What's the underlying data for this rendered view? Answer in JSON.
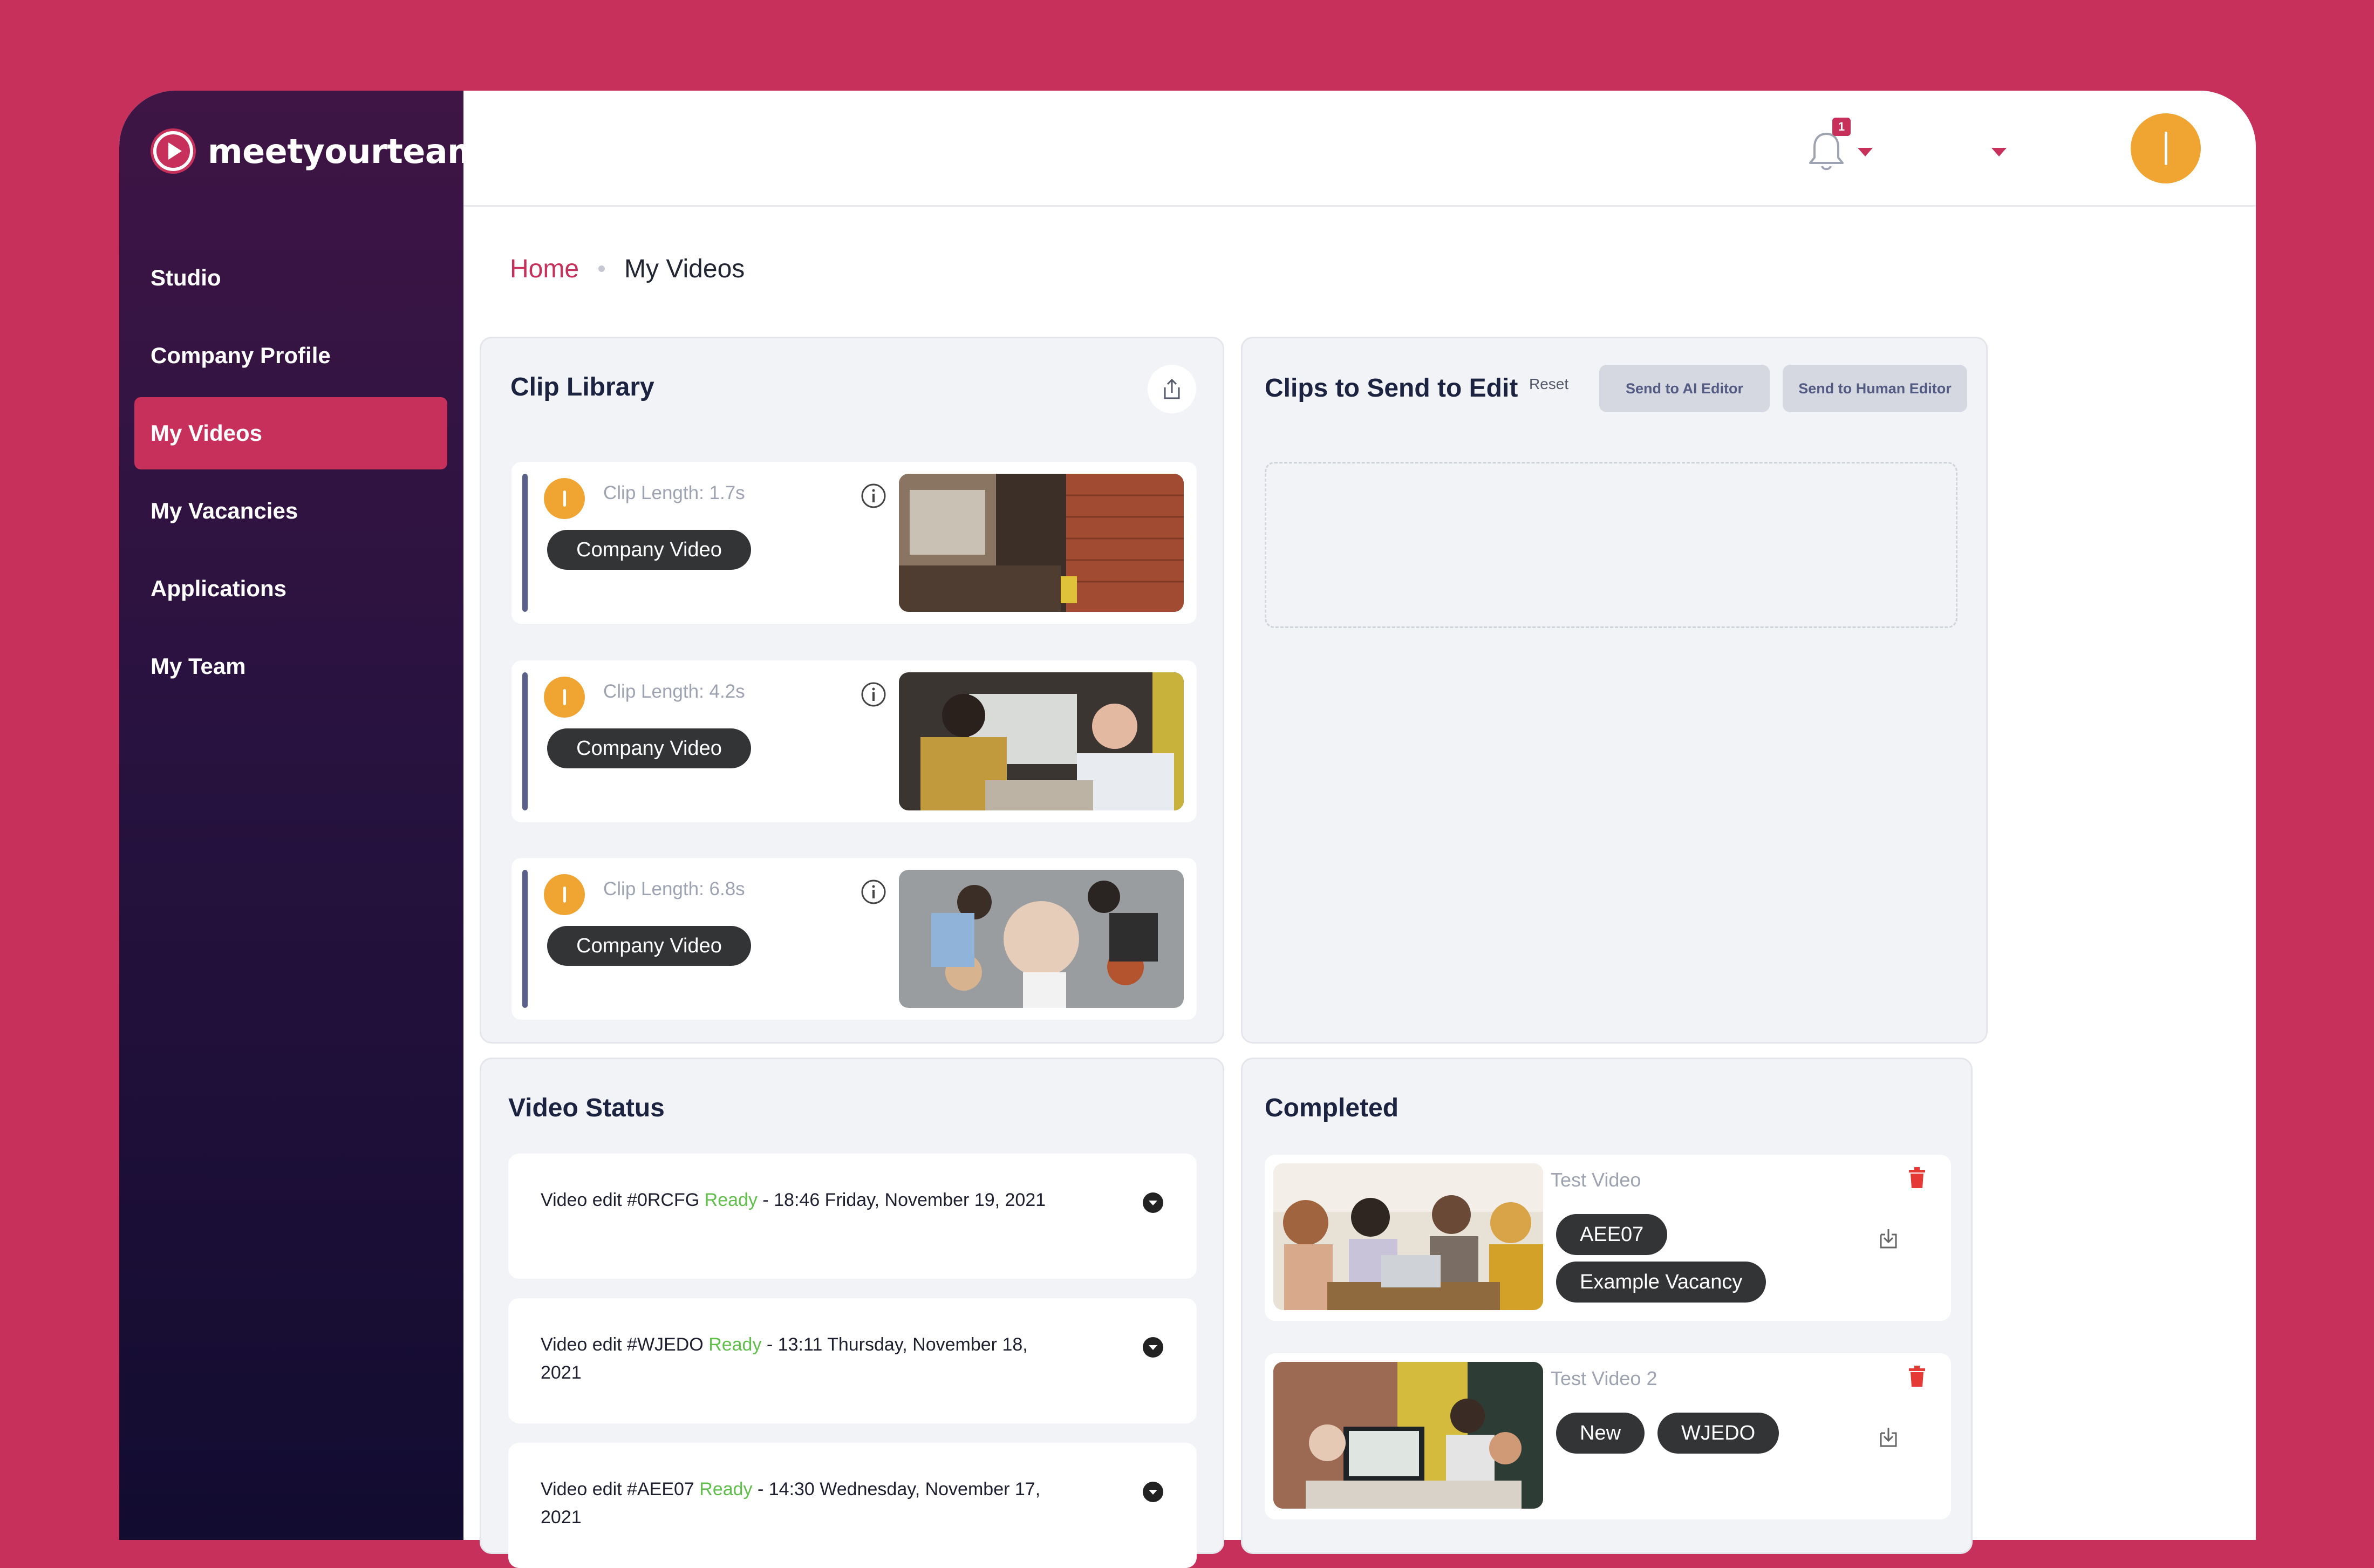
{
  "brand": {
    "name": "meetyourteam",
    "accent_color": "#c6305a",
    "logo_icon": "play-circle-icon"
  },
  "sidebar": {
    "items": [
      {
        "label": "Studio",
        "active": false
      },
      {
        "label": "Company Profile",
        "active": false
      },
      {
        "label": "My Videos",
        "active": true
      },
      {
        "label": "My Vacancies",
        "active": false
      },
      {
        "label": "Applications",
        "active": false
      },
      {
        "label": "My Team",
        "active": false
      }
    ]
  },
  "topbar": {
    "notification_icon": "bell-icon",
    "notification_count": "1",
    "avatar_color": "#f0a532"
  },
  "breadcrumb": {
    "home": "Home",
    "current": "My Videos"
  },
  "clip_library": {
    "title": "Clip Library",
    "upload_icon": "upload-icon",
    "clips": [
      {
        "length": "Clip Length: 1.7s",
        "tag": "Company Video"
      },
      {
        "length": "Clip Length: 4.2s",
        "tag": "Company Video"
      },
      {
        "length": "Clip Length: 6.8s",
        "tag": "Company Video"
      }
    ]
  },
  "send_to_edit": {
    "title": "Clips to Send to Edit",
    "reset": "Reset",
    "ai_editor": "Send to AI Editor",
    "human_editor": "Send to Human Editor"
  },
  "video_status": {
    "title": "Video Status",
    "items": [
      {
        "prefix": "Video edit #0RCFG ",
        "status": "Ready",
        "suffix": " - 18:46 Friday, November 19, 2021"
      },
      {
        "prefix": "Video edit #WJEDO ",
        "status": "Ready",
        "suffix": " - 13:11 Thursday, November 18, 2021"
      },
      {
        "prefix": "Video edit #AEE07 ",
        "status": "Ready",
        "suffix": " - 14:30 Wednesday, November 17, 2021"
      }
    ],
    "status_color": "#5fbf4a"
  },
  "completed": {
    "title": "Completed",
    "items": [
      {
        "title": "Test Video",
        "tags": [
          "AEE07",
          "Example Vacancy"
        ]
      },
      {
        "title": "Test Video 2",
        "tags": [
          "New",
          "WJEDO"
        ]
      }
    ]
  }
}
